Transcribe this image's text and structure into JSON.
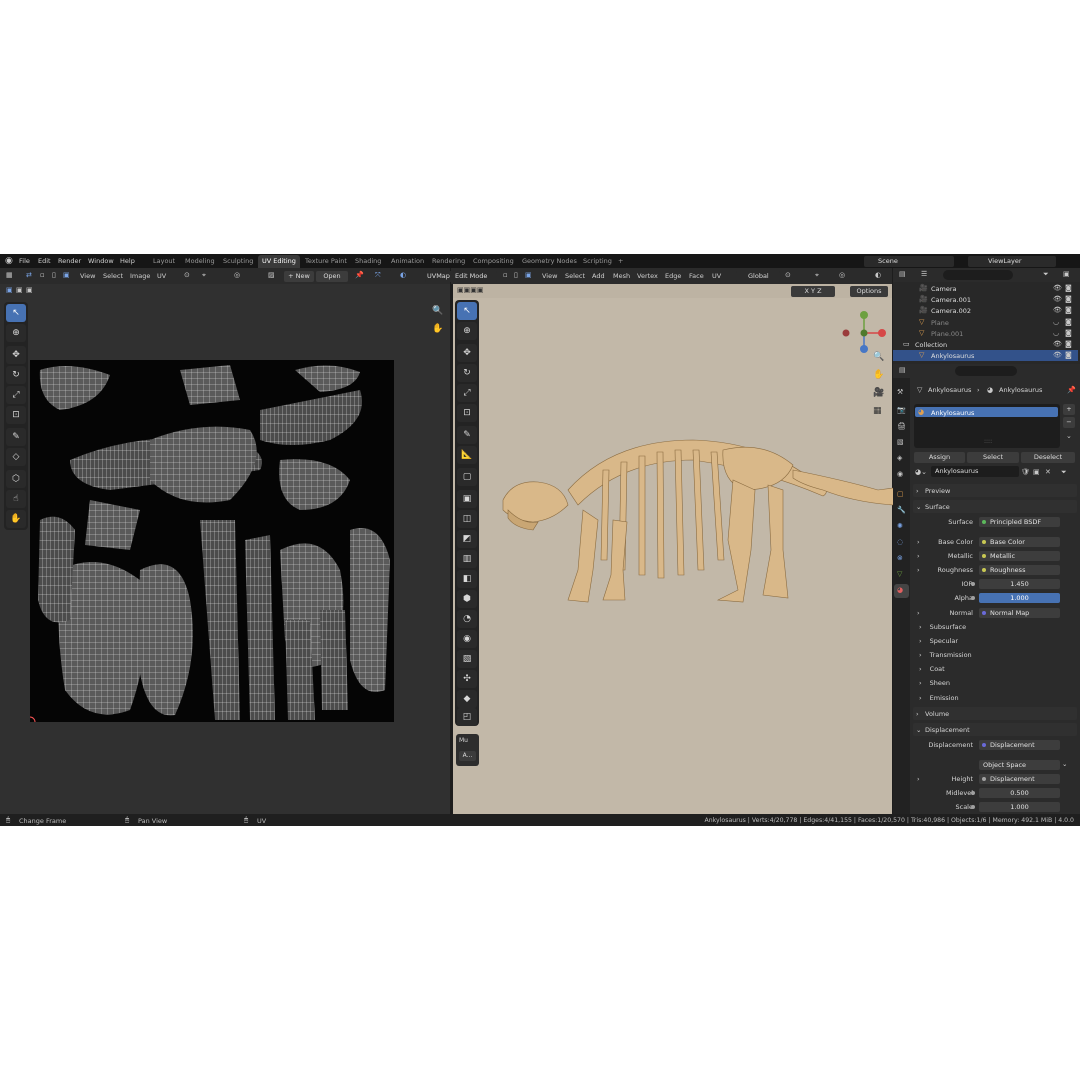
{
  "menu": [
    "File",
    "Edit",
    "Render",
    "Window",
    "Help"
  ],
  "workspaces": [
    "Layout",
    "Modeling",
    "Sculpting",
    "UV Editing",
    "Texture Paint",
    "Shading",
    "Animation",
    "Rendering",
    "Compositing",
    "Geometry Nodes",
    "Scripting"
  ],
  "workspace_add": "+",
  "scene": "Scene",
  "view_layer": "ViewLayer",
  "uv_editor": {
    "menus": [
      "View",
      "Select",
      "Image",
      "UV"
    ],
    "new_label": "+ New",
    "open_label": "Open",
    "uvmap": "UVMap"
  },
  "viewport": {
    "mode": "Edit Mode",
    "menus": [
      "View",
      "Select",
      "Add",
      "Mesh",
      "Vertex",
      "Edge",
      "Face",
      "UV"
    ],
    "orientation": "Global",
    "axes": [
      "X",
      "Y",
      "Z"
    ],
    "options_label": "Options",
    "gizmo_labels": [
      "Y",
      "X",
      "Z"
    ],
    "last_op_label": "Mu",
    "last_op_btn": "A..."
  },
  "outliner": {
    "items": [
      {
        "name": "Camera",
        "state": "visible"
      },
      {
        "name": "Camera.001",
        "state": "visible"
      },
      {
        "name": "Camera.002",
        "state": "visible"
      },
      {
        "name": "Plane",
        "state": "hidden"
      },
      {
        "name": "Plane.001",
        "state": "hidden"
      },
      {
        "name": "Collection",
        "state": "collection"
      },
      {
        "name": "Ankylosaurus",
        "state": "selected"
      }
    ]
  },
  "properties": {
    "breadcrumb_object": "Ankylosaurus",
    "breadcrumb_material": "Ankylosaurus",
    "slot": "Ankylosaurus",
    "assign": "Assign",
    "select": "Select",
    "deselect": "Deselect",
    "material_name": "Ankylosaurus",
    "preview": "Preview",
    "surface": "Surface",
    "surface_row": {
      "label": "Surface",
      "value": "Principled BSDF"
    },
    "fields": [
      {
        "label": "Base Color",
        "value": "Base Color"
      },
      {
        "label": "Metallic",
        "value": "Metallic"
      },
      {
        "label": "Roughness",
        "value": "Roughness"
      },
      {
        "label": "IOR",
        "value": "1.450"
      },
      {
        "label": "Alpha",
        "value": "1.000"
      },
      {
        "label": "Normal",
        "value": "Normal Map"
      }
    ],
    "subsections": [
      "Subsurface",
      "Specular",
      "Transmission",
      "Coat",
      "Sheen",
      "Emission"
    ],
    "volume": "Volume",
    "displacement": "Displacement",
    "disp_row": {
      "label": "Displacement",
      "value": "Displacement"
    },
    "space": "Object Space",
    "disp_fields": [
      {
        "label": "Height",
        "value": "Displacement"
      },
      {
        "label": "Midlevel",
        "value": "0.500"
      },
      {
        "label": "Scale",
        "value": "1.000"
      }
    ]
  },
  "status": {
    "left": "Change Frame",
    "mid": "Pan View",
    "right_tool": "UV",
    "stats": "Ankylosaurus | Verts:4/20,778 | Edges:4/41,155 | Faces:1/20,570 | Tris:40,986 | Objects:1/6 | Memory: 492.1 MiB | 4.0.0"
  },
  "colors": {
    "accent": "#4772b3",
    "bg": "#1d1d1d",
    "viewport_bg": "#c2b8a8",
    "bone": "#d9b889"
  }
}
